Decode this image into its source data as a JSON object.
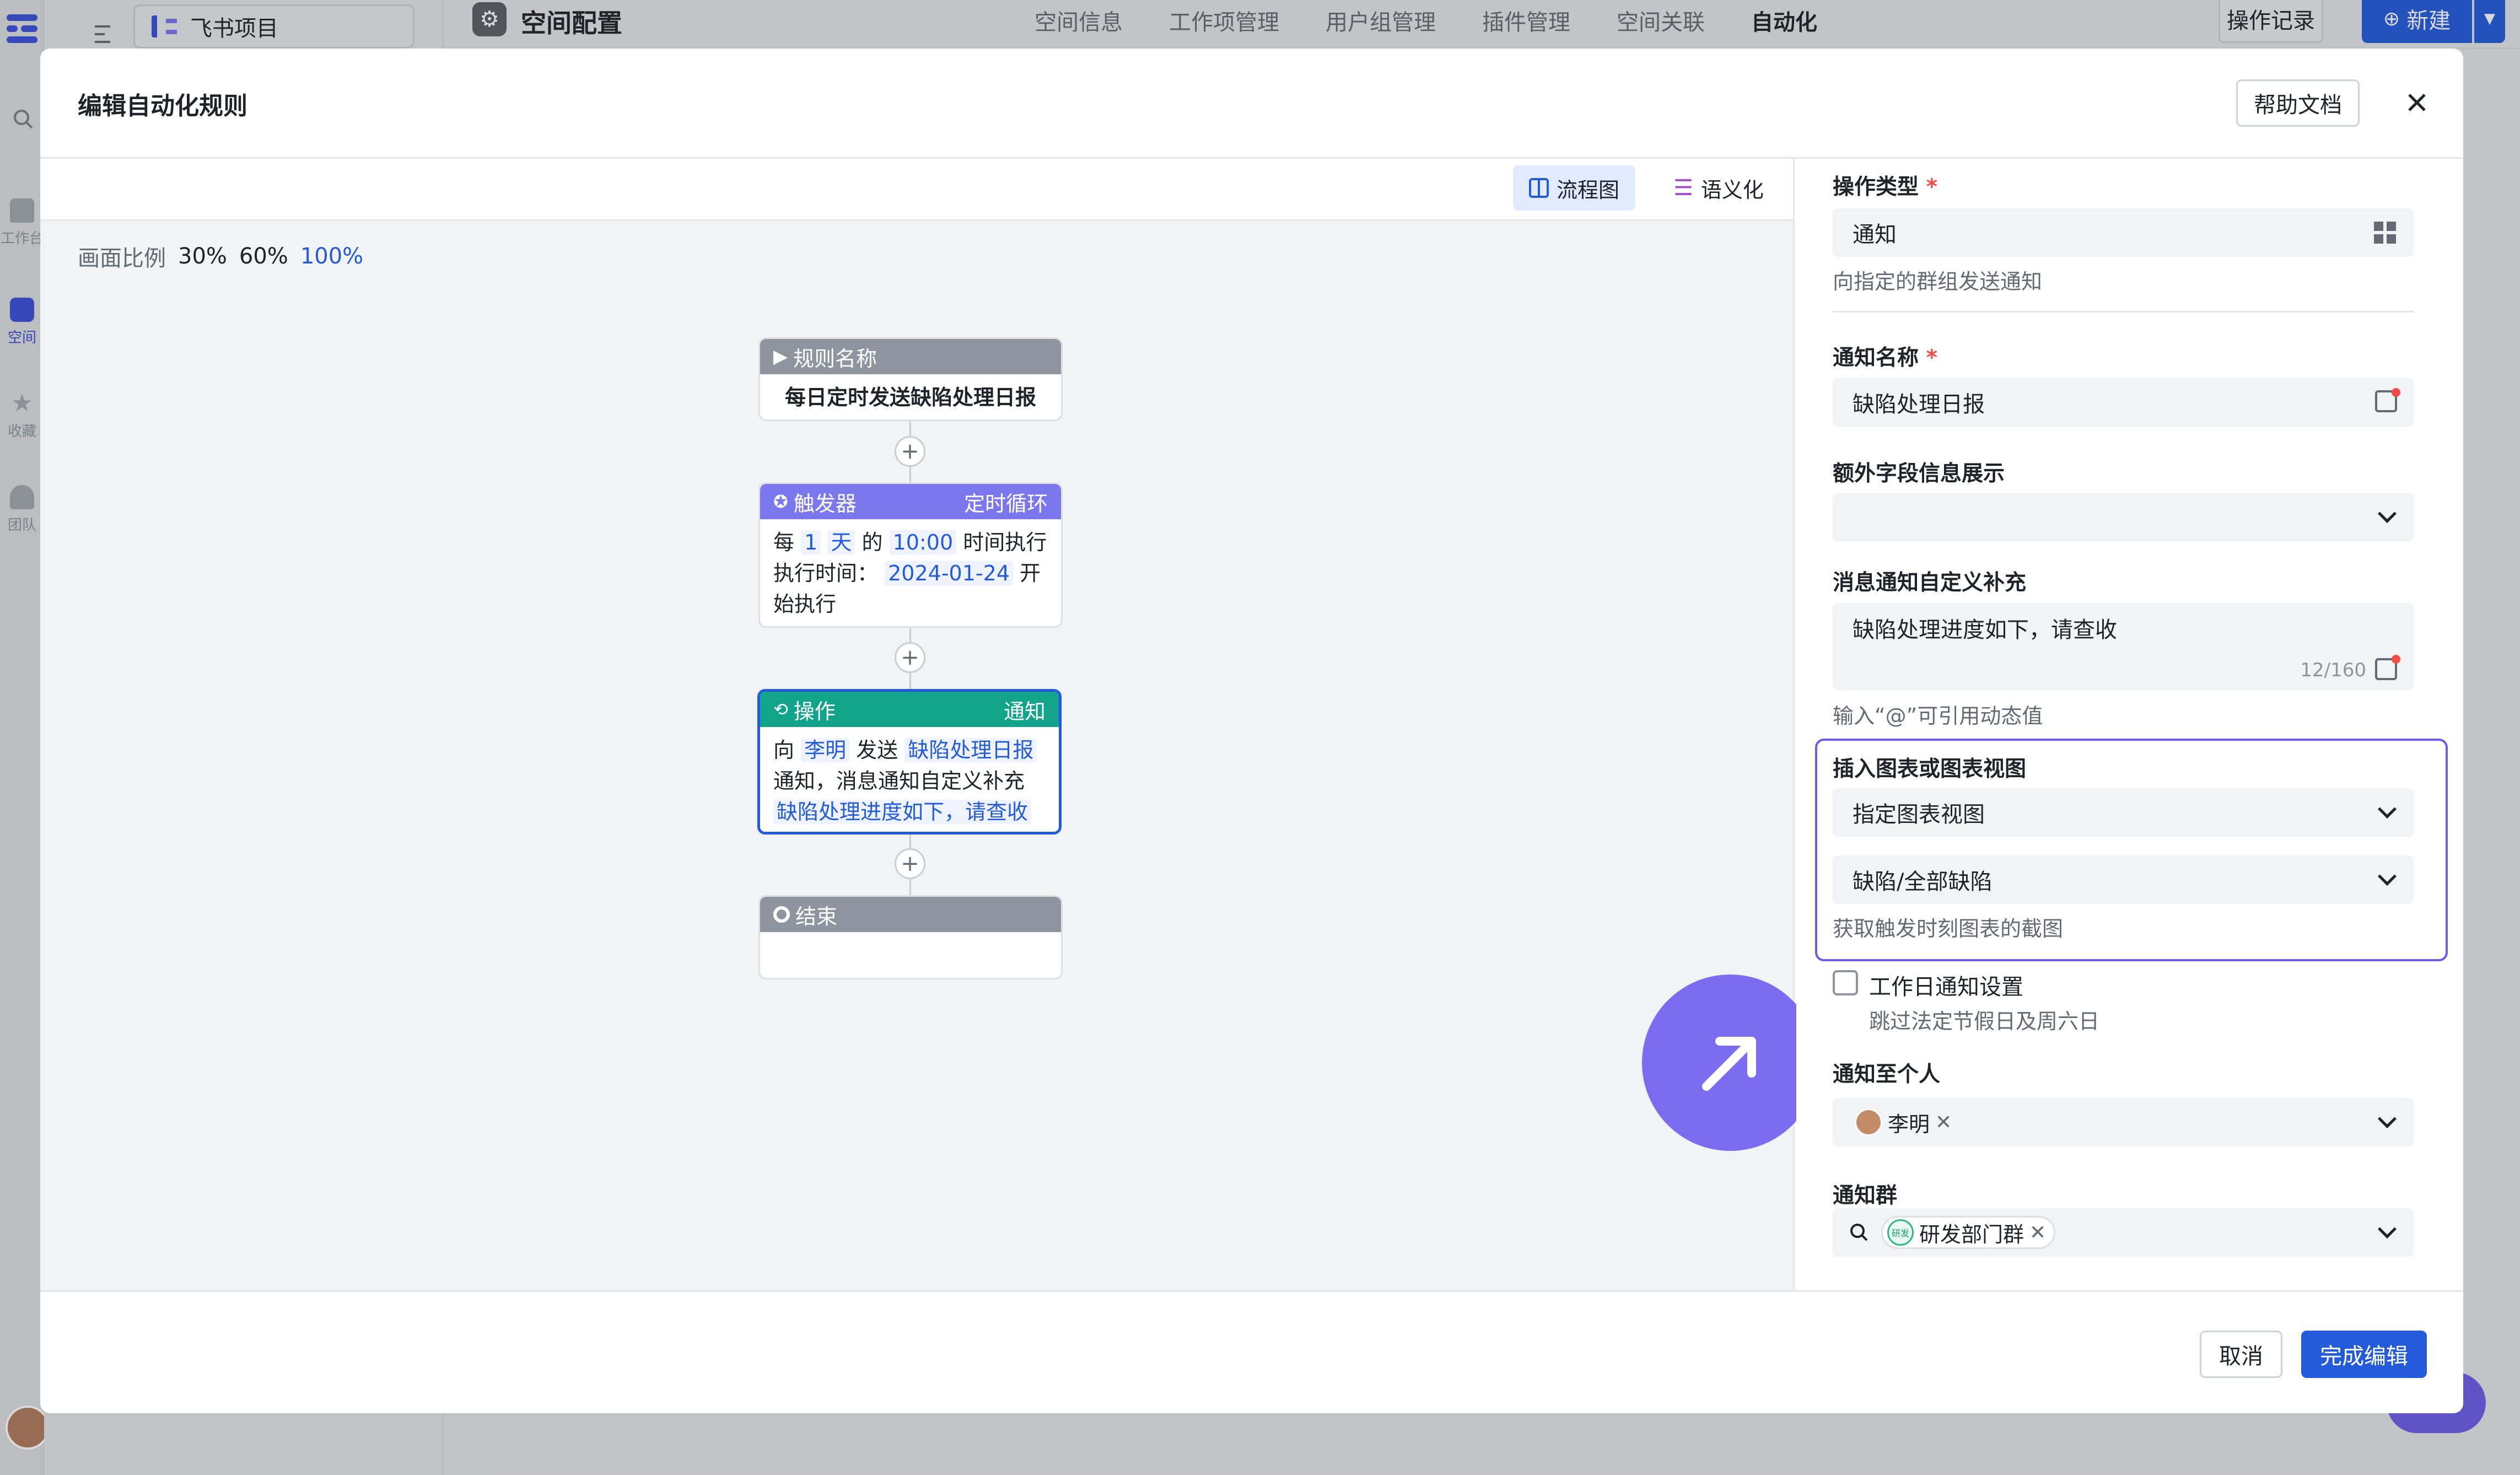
{
  "topbar": {
    "project_name": "飞书项目",
    "page_title": "空间配置",
    "nav": [
      "空间信息",
      "工作项管理",
      "用户组管理",
      "插件管理",
      "空间关联",
      "自动化"
    ],
    "ops_log": "操作记录",
    "new_btn": "新建"
  },
  "rail": {
    "items": [
      "工作台",
      "空间",
      "收藏",
      "团队"
    ]
  },
  "modal": {
    "title": "编辑自动化规则",
    "help": "帮助文档",
    "view_tabs": {
      "flow": "流程图",
      "semantic": "语义化"
    },
    "zoom_label": "画面比例",
    "zoom_options": [
      "30%",
      "60%",
      "100%"
    ],
    "zoom_selected": "100%",
    "cancel": "取消",
    "finish": "完成编辑"
  },
  "flow": {
    "rule": {
      "head": "规则名称",
      "body": "每日定时发送缺陷处理日报"
    },
    "trigger": {
      "head": "触发器",
      "type": "定时循环",
      "l1_a": "每",
      "l1_n": "1",
      "l1_u": "天",
      "l1_b": "的",
      "l1_t": "10:00",
      "l1_c": "时间执行",
      "l2_a": "执行时间：",
      "l2_d": "2024-01-24",
      "l2_b": "开",
      "l3": "始执行"
    },
    "action": {
      "head": "操作",
      "type": "通知",
      "l1_a": "向",
      "l1_who": "李明",
      "l1_b": "发送",
      "l1_what": "缺陷处理日报",
      "l2": "通知，消息通知自定义补充",
      "l3": "缺陷处理进度如下，请查收"
    },
    "end": {
      "head": "结束"
    },
    "plus": "+"
  },
  "form": {
    "op_type_label": "操作类型",
    "op_type_value": "通知",
    "op_type_hint": "向指定的群组发送通知",
    "name_label": "通知名称",
    "name_value": "缺陷处理日报",
    "extra_label": "额外字段信息展示",
    "extra_value": "",
    "msg_label": "消息通知自定义补充",
    "msg_value": "缺陷处理进度如下，请查收",
    "msg_count": "12/160",
    "msg_hint": "输入“@”可引用动态值",
    "chart_label": "插入图表或图表视图",
    "chart_select1": "指定图表视图",
    "chart_select2": "缺陷/全部缺陷",
    "chart_hint": "获取触发时刻图表的截图",
    "workday_label": "工作日通知设置",
    "workday_checked": false,
    "workday_hint": "跳过法定节假日及周六日",
    "person_label": "通知至个人",
    "person_tag": "李明",
    "group_label": "通知群",
    "group_tag": "研发部门群",
    "group_avatar_text": "研发"
  },
  "colors": {
    "primary": "#245bdb",
    "trigger_head": "#7b78ee",
    "action_head": "#11a48a",
    "gray_head": "#8f959e",
    "highlight_border": "#6c5ce7",
    "fab": "#7b6cf0"
  }
}
